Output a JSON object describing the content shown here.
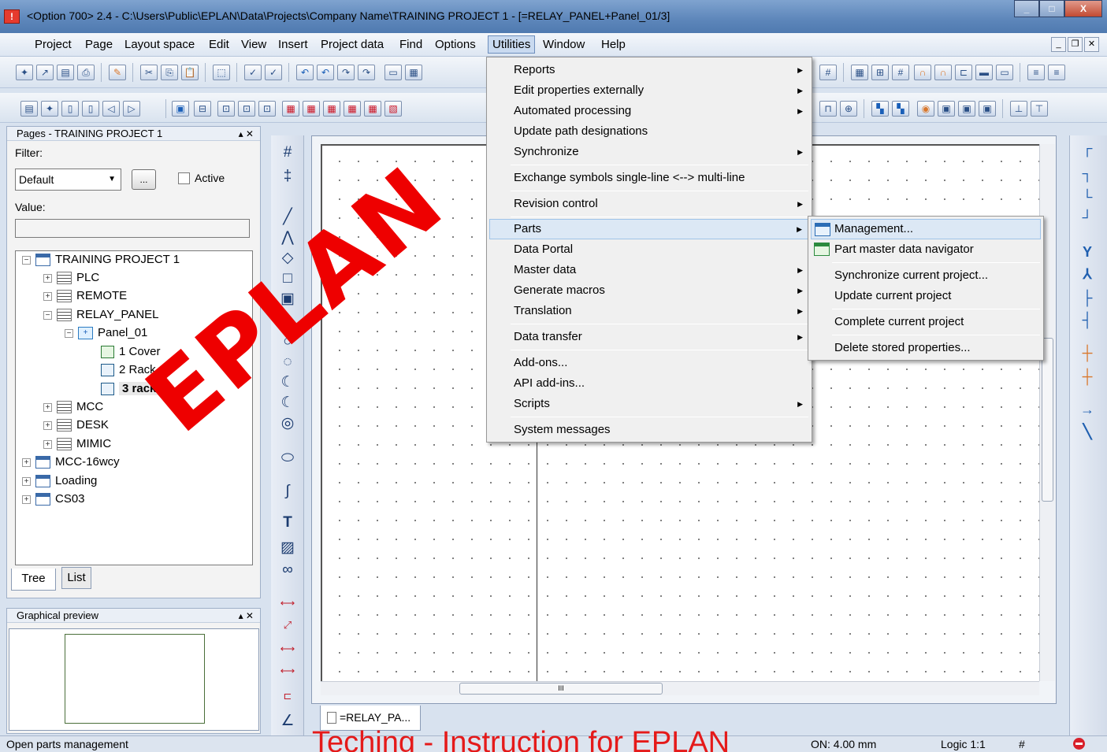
{
  "window": {
    "app_icon": "warning-triangle-icon",
    "title": "<Option 700> 2.4 - C:\\Users\\Public\\EPLAN\\Data\\Projects\\Company Name\\TRAINING PROJECT 1 - [=RELAY_PANEL+Panel_01/3]",
    "min_glyph": "_",
    "max_glyph": "□",
    "close_glyph": "X"
  },
  "menubar": {
    "items": [
      "Project",
      "Page",
      "Layout space",
      "Edit",
      "View",
      "Insert",
      "Project data",
      "Find",
      "Options",
      "Utilities",
      "Window",
      "Help"
    ],
    "active": "Utilities"
  },
  "pages_panel": {
    "title": "Pages - TRAINING PROJECT 1",
    "filter_label": "Filter:",
    "filter_value": "Default",
    "browse_label": "...",
    "active_label": "Active",
    "value_label": "Value:",
    "value_text": "",
    "tree": [
      {
        "label": "TRAINING PROJECT 1",
        "level": 0,
        "icon": "project-icon",
        "expanded": true
      },
      {
        "label": "PLC",
        "level": 1,
        "icon": "plant-icon",
        "expanded": false
      },
      {
        "label": "REMOTE",
        "level": 1,
        "icon": "plant-icon",
        "expanded": false
      },
      {
        "label": "RELAY_PANEL",
        "level": 1,
        "icon": "plant-icon",
        "expanded": true
      },
      {
        "label": "Panel_01",
        "level": 2,
        "icon": "location-icon",
        "expanded": true
      },
      {
        "label": "1 Cover",
        "level": 3,
        "icon": "cover-page-icon"
      },
      {
        "label": "2 Rack 1",
        "level": 3,
        "icon": "page-icon"
      },
      {
        "label": "3 rack 2",
        "level": 3,
        "icon": "page-icon",
        "selected": true
      },
      {
        "label": "MCC",
        "level": 1,
        "icon": "plant-icon",
        "expanded": false
      },
      {
        "label": "DESK",
        "level": 1,
        "icon": "plant-icon",
        "expanded": false
      },
      {
        "label": "MIMIC",
        "level": 1,
        "icon": "plant-icon",
        "expanded": false
      },
      {
        "label": "MCC-16wcy",
        "level": 0,
        "icon": "project-icon",
        "expanded": false
      },
      {
        "label": "Loading",
        "level": 0,
        "icon": "project-icon",
        "expanded": false
      },
      {
        "label": "CS03",
        "level": 0,
        "icon": "project-icon",
        "expanded": false
      }
    ],
    "tabs": [
      "Tree",
      "List"
    ],
    "active_tab": "Tree"
  },
  "preview_panel": {
    "title": "Graphical preview"
  },
  "utilities_menu": {
    "items": [
      {
        "label": "Reports",
        "submenu": true
      },
      {
        "label": "Edit properties externally",
        "submenu": true
      },
      {
        "label": "Automated processing",
        "submenu": true
      },
      {
        "label": "Update path designations",
        "submenu": false
      },
      {
        "label": "Synchronize",
        "submenu": true
      },
      {
        "label": "Exchange symbols single-line <--> multi-line",
        "submenu": false
      },
      {
        "label": "Revision control",
        "submenu": true
      },
      {
        "label": "Parts",
        "submenu": true,
        "highlighted": true
      },
      {
        "label": "Data Portal",
        "submenu": false
      },
      {
        "label": "Master data",
        "submenu": true
      },
      {
        "label": "Generate macros",
        "submenu": true
      },
      {
        "label": "Translation",
        "submenu": true
      },
      {
        "label": "Data transfer",
        "submenu": true
      },
      {
        "label": "Add-ons...",
        "submenu": false
      },
      {
        "label": "API add-ins...",
        "submenu": false
      },
      {
        "label": "Scripts",
        "submenu": true
      },
      {
        "label": "System messages",
        "submenu": false
      }
    ]
  },
  "parts_submenu": {
    "items": [
      {
        "label": "Management...",
        "icon": "parts-management-icon",
        "highlighted": true
      },
      {
        "label": "Part master data navigator",
        "icon": "part-navigator-icon"
      },
      {
        "label": "Synchronize current project..."
      },
      {
        "label": "Update current project"
      },
      {
        "label": "Complete current project"
      },
      {
        "label": "Delete stored properties..."
      }
    ]
  },
  "document_tab": {
    "label": "=RELAY_PA..."
  },
  "hscroll_grip": "III",
  "statusbar": {
    "message": "Open parts management",
    "grid": "ON: 4.00 mm",
    "logic": "Logic 1:1",
    "hash": "#"
  },
  "overlay": {
    "watermark": "EPLAN",
    "caption": "Teching - Instruction for EPLAN"
  },
  "colors": {
    "watermark": "#ee0000",
    "menu_highlight": "#dce8f5",
    "titlebar": "#5d86ba"
  }
}
